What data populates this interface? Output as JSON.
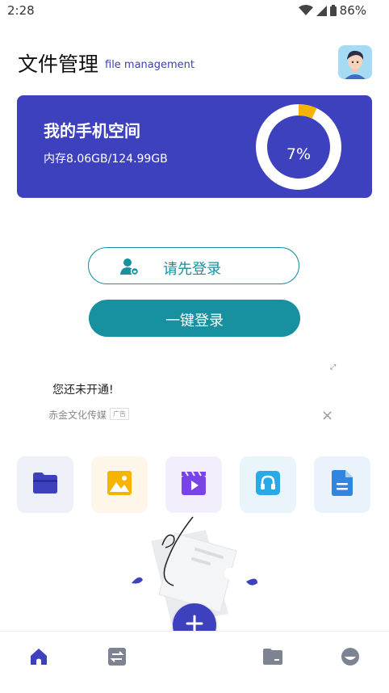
{
  "status_bar": {
    "time": "2:28",
    "battery": "86%"
  },
  "header": {
    "title": "文件管理",
    "subtitle": "file management"
  },
  "storage": {
    "title": "我的手机空间",
    "usage_text": "内存8.06GB/124.99GB",
    "percent_label": "7%",
    "used_fraction": 0.07,
    "ring_colors": {
      "track": "#ffffff",
      "used": "#f5b400"
    }
  },
  "login": {
    "primary_label": "请先登录",
    "one_click_label": "一键登录"
  },
  "ad": {
    "title": "您还未开通!",
    "source": "赤金文化传媒",
    "badge": "广告"
  },
  "categories": [
    {
      "icon": "folder-icon",
      "color": "#3d41bd"
    },
    {
      "icon": "image-icon",
      "color": "#f5b400"
    },
    {
      "icon": "video-icon",
      "color": "#7a43ea"
    },
    {
      "icon": "headphones-icon",
      "color": "#29a9e6"
    },
    {
      "icon": "document-icon",
      "color": "#2f86e0"
    }
  ],
  "bottom_nav": [
    {
      "icon": "home-icon",
      "active": true
    },
    {
      "icon": "transfer-icon",
      "active": false
    },
    {
      "icon": "folder-icon",
      "active": false
    },
    {
      "icon": "profile-icon",
      "active": false
    }
  ],
  "colors": {
    "brand": "#3d41bd",
    "teal": "#17909f",
    "nav_inactive": "#7d8390"
  }
}
